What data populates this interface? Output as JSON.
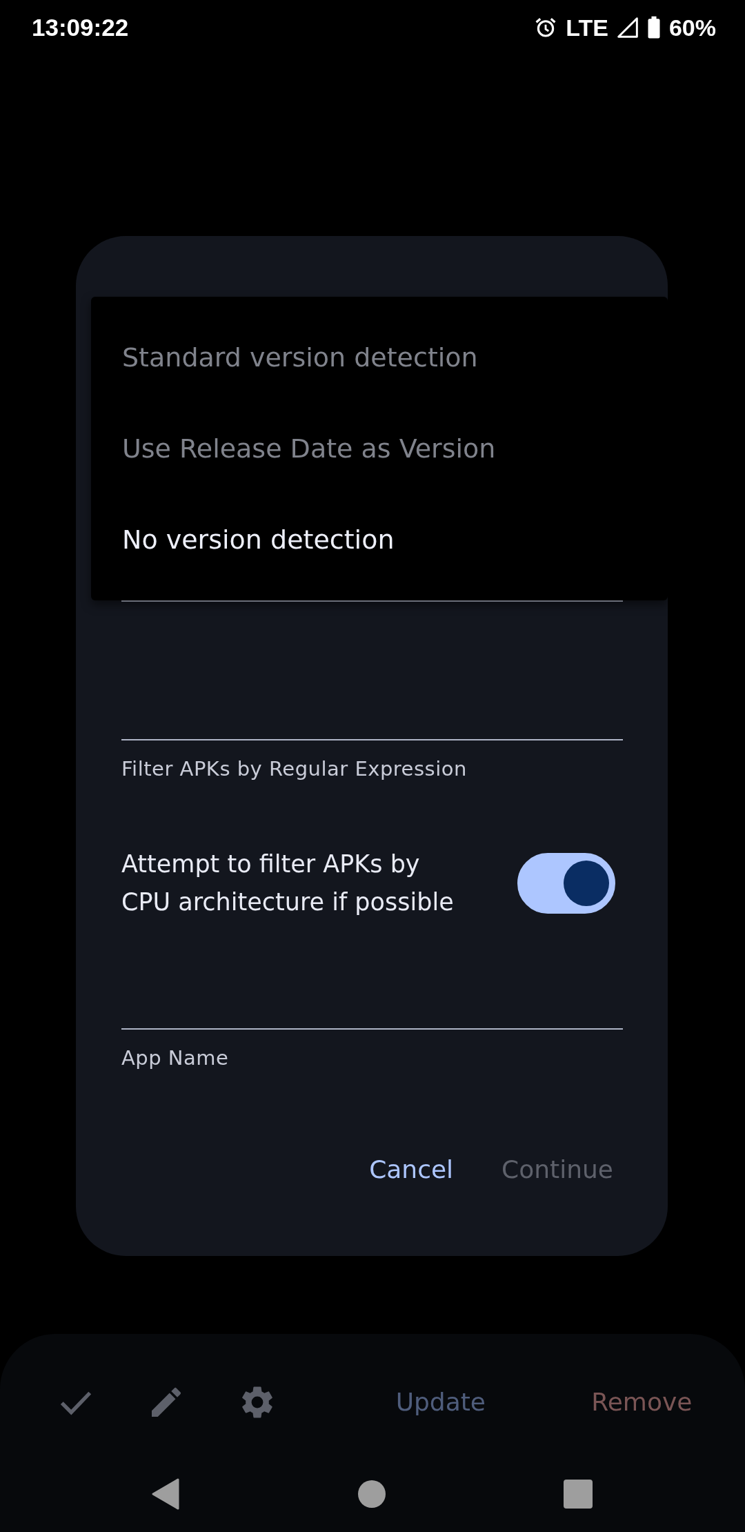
{
  "status_bar": {
    "time": "13:09:22",
    "network": "LTE",
    "battery": "60%"
  },
  "dialog": {
    "menu_options": [
      {
        "label": "Standard version detection",
        "selected": false
      },
      {
        "label": "Use Release Date as Version",
        "selected": false
      },
      {
        "label": "No version detection",
        "selected": true
      }
    ],
    "regex_field": {
      "label": "Filter APKs by Regular Expression"
    },
    "cpu_filter": {
      "label": "Attempt to filter APKs by CPU architecture if possible",
      "on": true
    },
    "app_name_field": {
      "label": "App Name"
    },
    "buttons": [
      {
        "label": "Cancel",
        "disabled": false
      },
      {
        "label": "Continue",
        "disabled": true
      }
    ]
  },
  "bottom_bar": {
    "actions": [
      {
        "label": "Update",
        "kind": "primary"
      },
      {
        "label": "Remove",
        "kind": "danger"
      }
    ]
  }
}
